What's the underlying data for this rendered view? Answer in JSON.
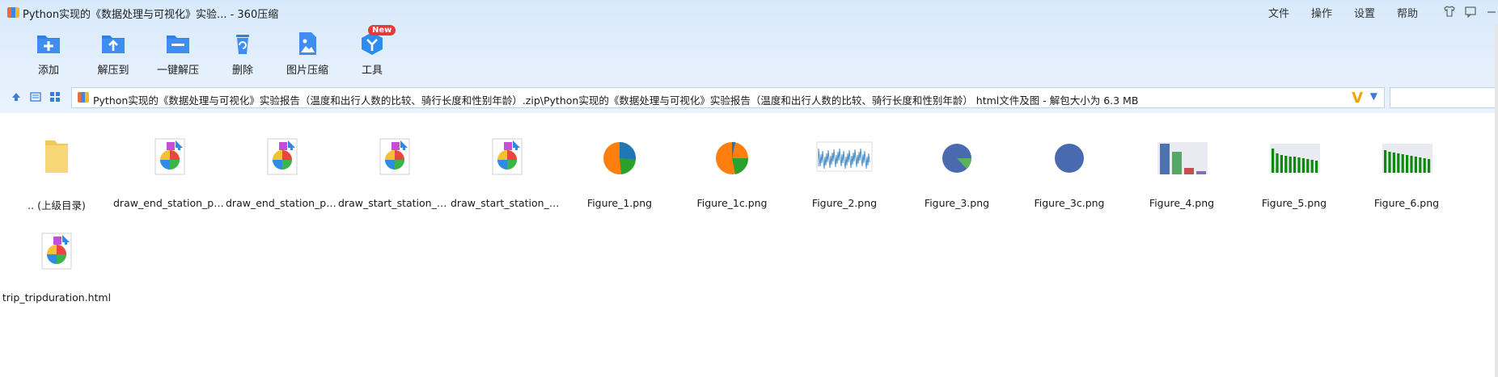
{
  "window": {
    "title": "Python实现的《数据处理与可视化》实验... - 360压缩"
  },
  "menus": [
    "文件",
    "操作",
    "设置",
    "帮助"
  ],
  "toolbar": {
    "items": [
      {
        "label": "添加",
        "icon": "add-archive-icon"
      },
      {
        "label": "解压到",
        "icon": "extract-to-icon"
      },
      {
        "label": "一键解压",
        "icon": "one-click-extract-icon"
      },
      {
        "label": "删除",
        "icon": "delete-icon"
      },
      {
        "label": "图片压缩",
        "icon": "image-compress-icon"
      },
      {
        "label": "工具",
        "icon": "tools-icon"
      }
    ],
    "new_badge": "New"
  },
  "address": {
    "path": "Python实现的《数据处理与可视化》实验报告（温度和出行人数的比较、骑行长度和性别年龄）.zip\\Python实现的《数据处理与可视化》实验报告（温度和出行人数的比较、骑行长度和性别年龄） html文件及图 - 解包大小为 6.3 MB",
    "badge": "V"
  },
  "files": [
    {
      "name": ".. (上级目录)",
      "type": "folder"
    },
    {
      "name": "draw_end_station_po...",
      "type": "html"
    },
    {
      "name": "draw_end_station_po...",
      "type": "html"
    },
    {
      "name": "draw_start_station_po...",
      "type": "html"
    },
    {
      "name": "draw_start_station_p...",
      "type": "html"
    },
    {
      "name": "Figure_1.png",
      "type": "pie-blue"
    },
    {
      "name": "Figure_1c.png",
      "type": "pie-orange"
    },
    {
      "name": "Figure_2.png",
      "type": "line"
    },
    {
      "name": "Figure_3.png",
      "type": "pie-small"
    },
    {
      "name": "Figure_3c.png",
      "type": "pie-solid"
    },
    {
      "name": "Figure_4.png",
      "type": "bar4"
    },
    {
      "name": "Figure_5.png",
      "type": "bar-green"
    },
    {
      "name": "Figure_6.png",
      "type": "bar-green2"
    },
    {
      "name": "trip_tripduration.html",
      "type": "html"
    }
  ],
  "colors": {
    "accent": "#3b7ed8",
    "toolbar_bg": "#dceafb",
    "pie_blue": "#1f77b4",
    "pie_orange": "#ff7f0e",
    "pie_green": "#2ca02c"
  }
}
